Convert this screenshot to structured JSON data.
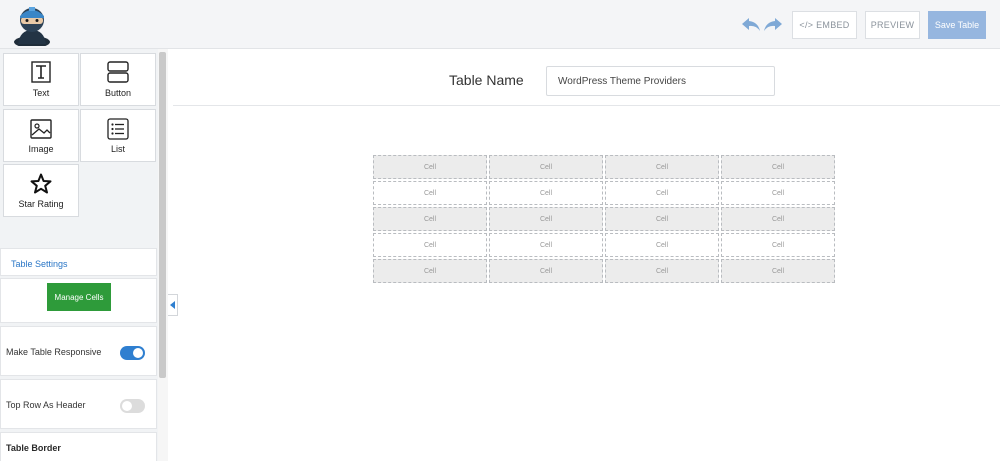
{
  "header": {
    "embed_label": "</> EMBED",
    "preview_label": "PREVIEW",
    "save_label": "Save Table",
    "accent_color": "#96b6df"
  },
  "elements": [
    {
      "label": "Text",
      "icon": "text-icon"
    },
    {
      "label": "Button",
      "icon": "button-icon"
    },
    {
      "label": "Image",
      "icon": "image-icon"
    },
    {
      "label": "List",
      "icon": "list-icon"
    },
    {
      "label": "Star Rating",
      "icon": "star-icon"
    }
  ],
  "settings": {
    "title": "Table Settings",
    "manage_cells": "Manage Cells",
    "responsive": {
      "label": "Make Table Responsive",
      "on": true
    },
    "top_row_header": {
      "label": "Top Row As Header",
      "on": false
    },
    "table_border": "Table Border"
  },
  "main": {
    "table_name_label": "Table Name",
    "table_name_value": "WordPress Theme Providers"
  },
  "table": {
    "rows": [
      [
        "Cell",
        "Cell",
        "Cell",
        "Cell"
      ],
      [
        "Cell",
        "Cell",
        "Cell",
        "Cell"
      ],
      [
        "Cell",
        "Cell",
        "Cell",
        "Cell"
      ],
      [
        "Cell",
        "Cell",
        "Cell",
        "Cell"
      ],
      [
        "Cell",
        "Cell",
        "Cell",
        "Cell"
      ]
    ]
  }
}
